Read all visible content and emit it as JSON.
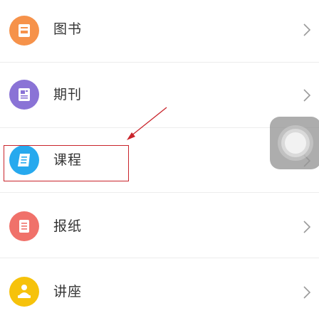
{
  "menu": {
    "items": [
      {
        "label": "图书",
        "icon": "book-icon",
        "color": "#f6924a"
      },
      {
        "label": "期刊",
        "icon": "journal-icon",
        "color": "#8a73d6"
      },
      {
        "label": "课程",
        "icon": "course-icon",
        "color": "#27a9ee"
      },
      {
        "label": "报纸",
        "icon": "newspaper-icon",
        "color": "#f0716a"
      },
      {
        "label": "讲座",
        "icon": "lecture-icon",
        "color": "#f6c20b"
      }
    ],
    "chevron": "chevron-right-icon"
  },
  "annotation": {
    "highlighted_item": "课程",
    "color": "#c9242b"
  },
  "assistive_touch": {
    "icon": "assistive-touch-button"
  }
}
